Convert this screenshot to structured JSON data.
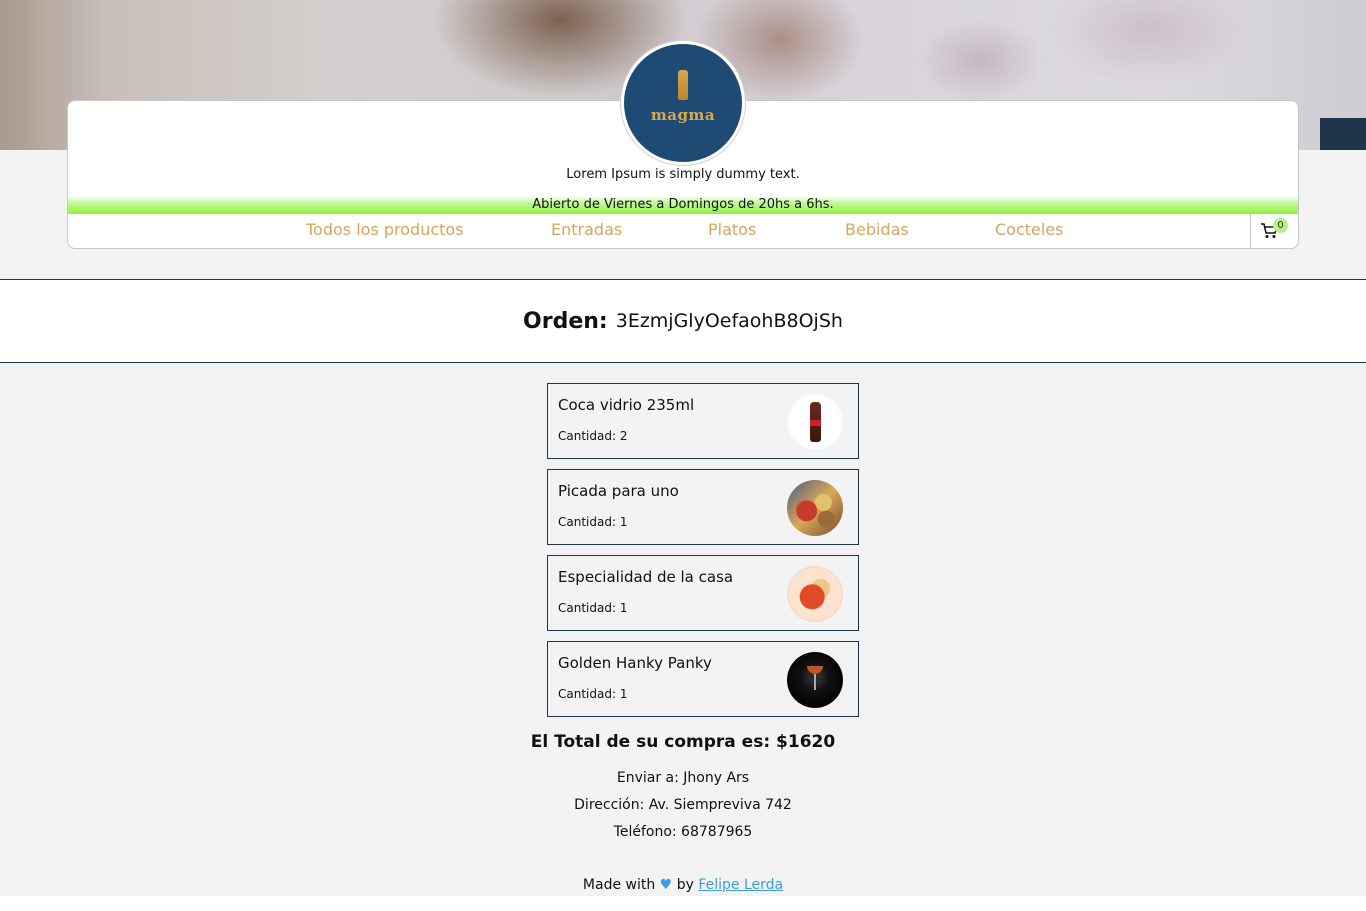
{
  "header": {
    "logo_text": "magma",
    "tagline": "Lorem Ipsum is simply dummy text.",
    "hours": "Abierto de Viernes a Domingos de 20hs a 6hs."
  },
  "nav": {
    "items": [
      {
        "label": "Todos los productos"
      },
      {
        "label": "Entradas"
      },
      {
        "label": "Platos"
      },
      {
        "label": "Bebidas"
      },
      {
        "label": "Cocteles"
      }
    ],
    "cart_count": "0"
  },
  "order": {
    "label": "Orden:",
    "id": "3EzmjGlyOefaohB8OjSh"
  },
  "items": [
    {
      "name": "Coca vidrio 235ml",
      "qty": "Cantidad: 2"
    },
    {
      "name": "Picada para uno",
      "qty": "Cantidad: 1"
    },
    {
      "name": "Especialidad de la casa",
      "qty": "Cantidad: 1"
    },
    {
      "name": "Golden Hanky Panky",
      "qty": "Cantidad: 1"
    }
  ],
  "summary": {
    "total": "El Total de su compra es: $1620",
    "send_to": "Enviar a: Jhony Ars",
    "address": "Dirección: Av. Siempreviva 742",
    "phone": "Teléfono: 68787965"
  },
  "footer": {
    "made_with": "Made with",
    "heart": "♥",
    "by": "by",
    "author": "Felipe Lerda"
  }
}
